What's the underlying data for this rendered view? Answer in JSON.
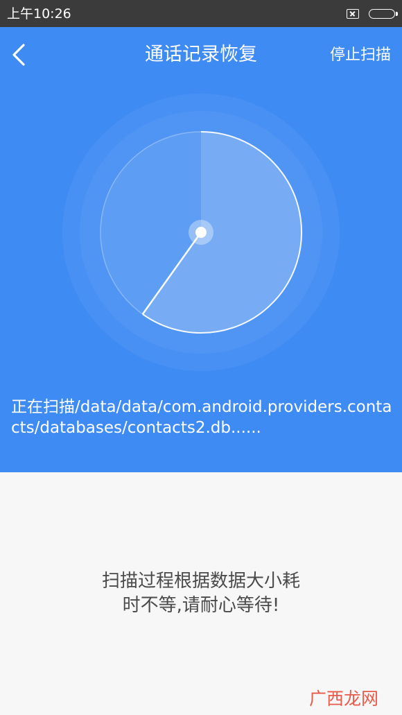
{
  "status_bar": {
    "time": "上午10:26",
    "icons": [
      "notification-blocked-icon",
      "battery-icon"
    ]
  },
  "header": {
    "back_icon": "chevron-left-icon",
    "title": "通话记录恢复",
    "stop_label": "停止扫描"
  },
  "scan": {
    "status_text": "正在扫描/data/data/com.android.providers.contacts/databases/contacts2.db......"
  },
  "content": {
    "message_line1": "扫描过程根据数据大小耗",
    "message_line2": "时不等,请耐心等待!"
  },
  "watermark": {
    "text": "广西龙网"
  },
  "colors": {
    "status_bar": "#3b3b3b",
    "header_blue": "#3f8bf4",
    "content_bg": "#f7f7f7",
    "message_text": "#4a4a4a",
    "watermark": "#e85b4a"
  }
}
